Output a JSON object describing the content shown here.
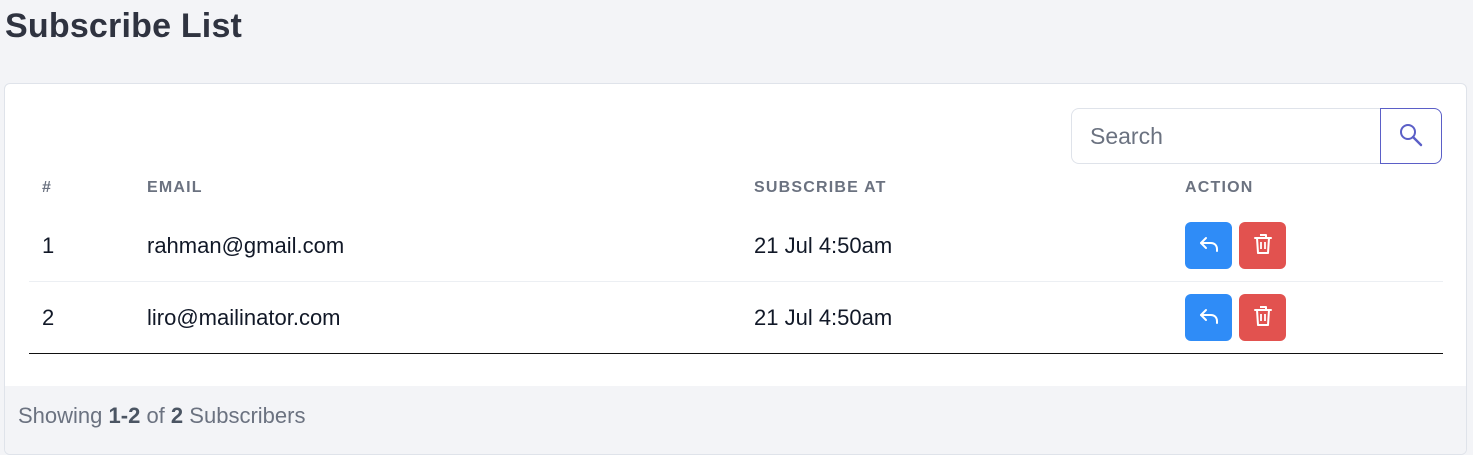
{
  "page": {
    "title": "Subscribe List"
  },
  "search": {
    "placeholder": "Search",
    "value": "",
    "button_icon": "search-icon"
  },
  "table": {
    "columns": [
      "#",
      "EMAIL",
      "SUBSCRIBE AT",
      "ACTION"
    ],
    "rows": [
      {
        "index": "1",
        "email": "rahman@gmail.com",
        "subscribed_at": "21 Jul 4:50am",
        "actions": [
          "reply-icon",
          "trash-icon"
        ]
      },
      {
        "index": "2",
        "email": "liro@mailinator.com",
        "subscribed_at": "21 Jul 4:50am",
        "actions": [
          "reply-icon",
          "trash-icon"
        ]
      }
    ]
  },
  "footer": {
    "prefix": "Showing",
    "range": "1-2",
    "of": "of",
    "total": "2",
    "suffix": "Subscribers"
  },
  "colors": {
    "reply_button": "#2f8cf7",
    "delete_button": "#e2524f",
    "search_button_border": "#5b5fc7",
    "page_background": "#f3f4f7"
  }
}
